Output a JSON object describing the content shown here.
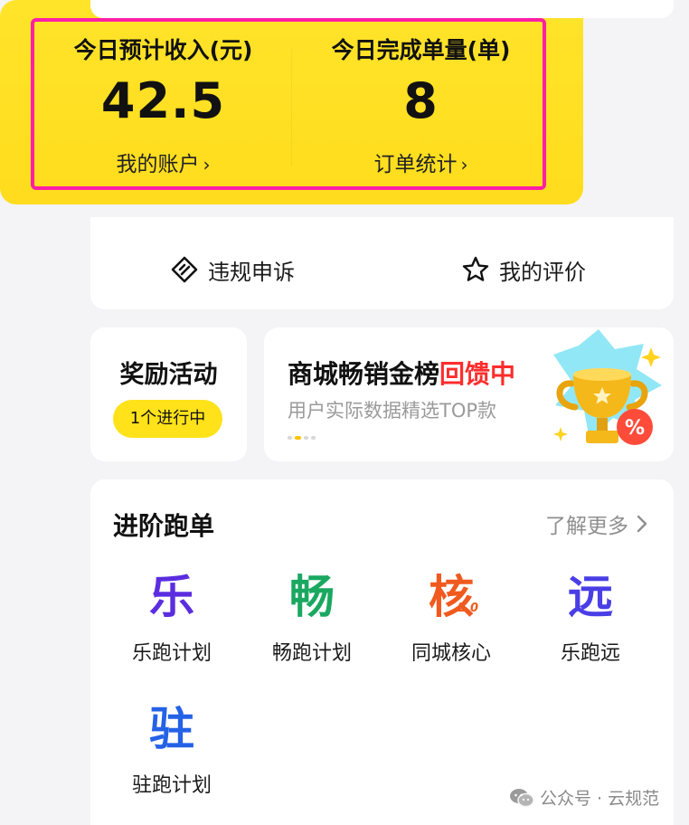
{
  "earnings": {
    "income_label": "今日预计收入(元)",
    "income_value": "42.5",
    "account_link": "我的账户",
    "orders_label": "今日完成单量(单)",
    "orders_value": "8",
    "orders_link": "订单统计",
    "chevron": "›"
  },
  "actions": {
    "appeal": "违规申诉",
    "reviews": "我的评价"
  },
  "rewards": {
    "title": "奖励活动",
    "badge": "1个进行中"
  },
  "banner": {
    "title_main": "商城畅销金榜",
    "title_highlight": "回馈中",
    "subtitle": "用户实际数据精选TOP款",
    "badge_symbol": "%"
  },
  "advanced": {
    "title": "进阶跑单",
    "more_link": "了解更多",
    "plans": [
      {
        "glyph": "乐",
        "label": "乐跑计划",
        "color": "#5b2de0"
      },
      {
        "glyph": "畅",
        "label": "畅跑计划",
        "color": "#1aa860"
      },
      {
        "glyph": "核",
        "label": "同城核心",
        "color": "#f05a1e",
        "sup": "2.0"
      },
      {
        "glyph": "远",
        "label": "乐跑远",
        "color": "#4a3ee6"
      },
      {
        "glyph": "驻",
        "label": "驻跑计划",
        "color": "#2462e6"
      }
    ]
  },
  "watermark": "公众号 · 云规范",
  "colors": {
    "accent_yellow": "#ffe21a",
    "highlight_frame": "#ff1fa6",
    "banner_highlight": "#ff2d2d"
  }
}
